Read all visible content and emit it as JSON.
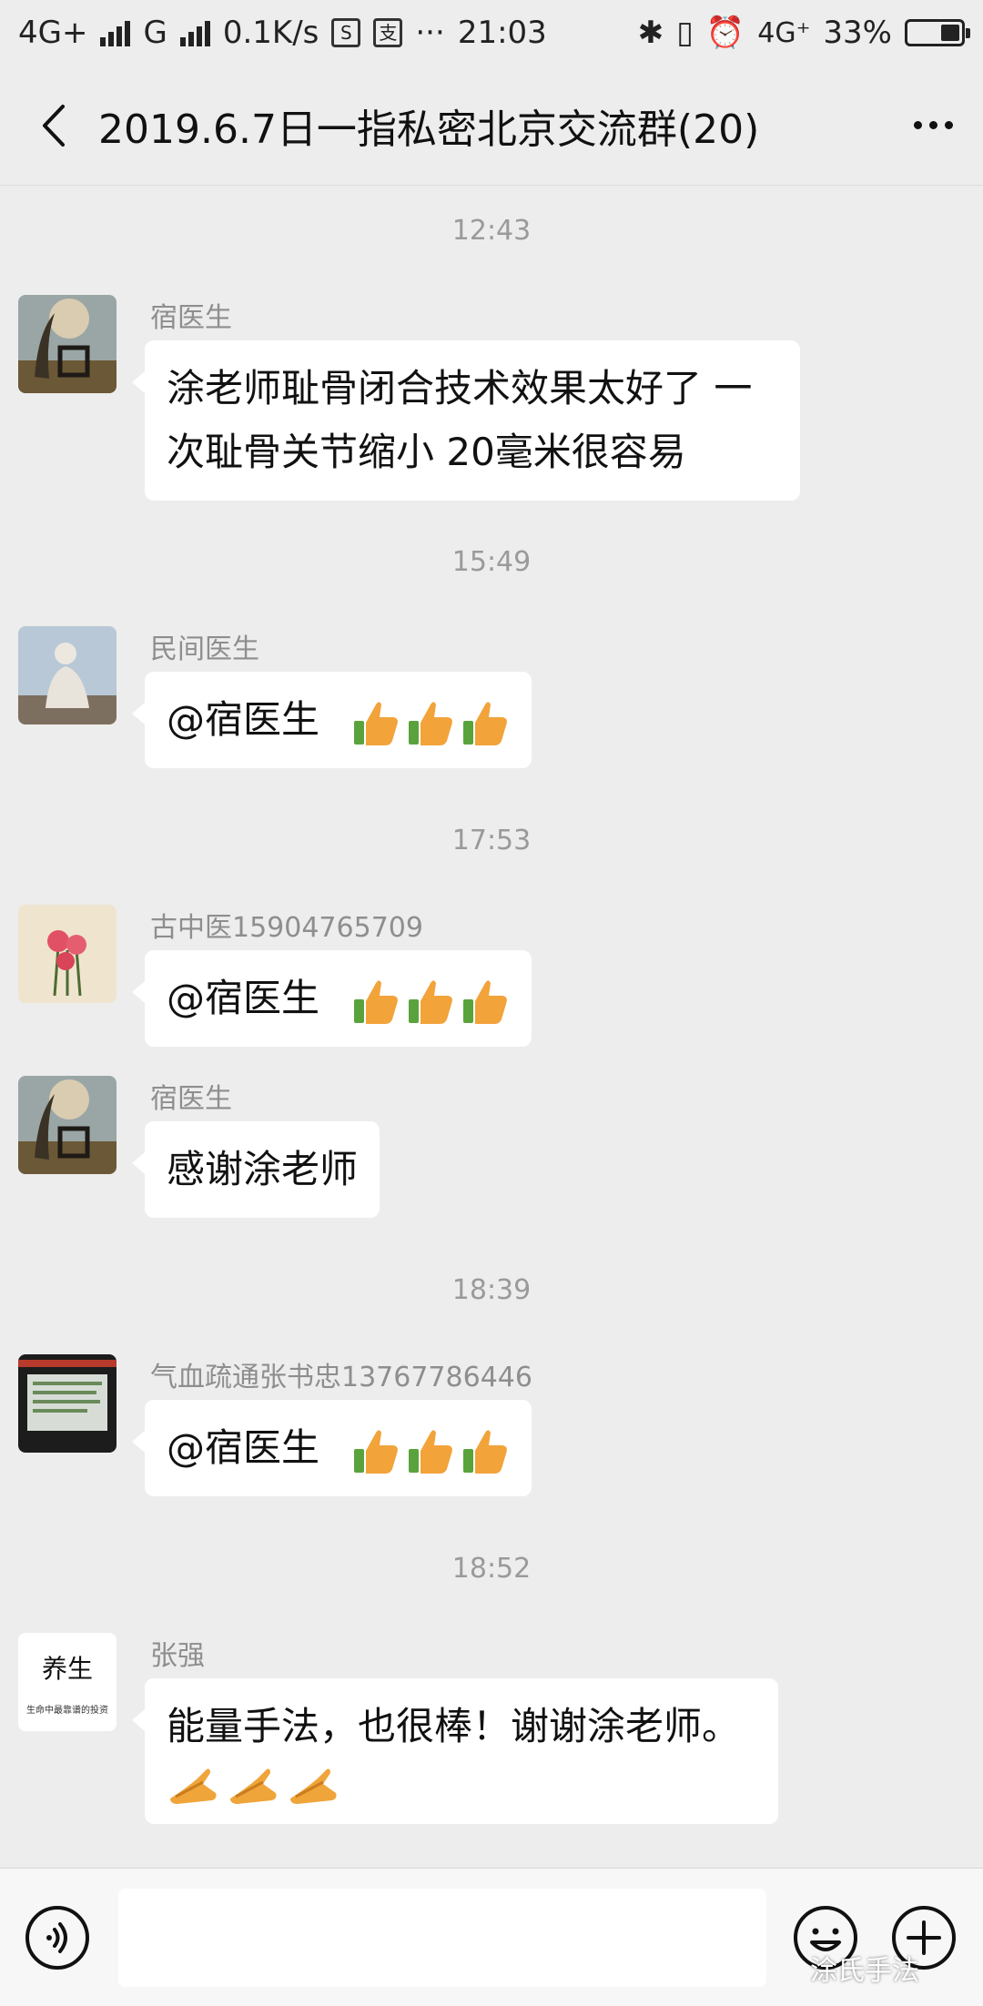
{
  "status_bar": {
    "net1": "4G+",
    "net2": "G",
    "speed": "0.1K/s",
    "icon_s": "S",
    "time": "21:03",
    "net3": "4G⁺",
    "battery": "33%"
  },
  "header": {
    "back_icon": "chevron-left-icon",
    "title": "2019.6.7日一指私密北京交流群(20)",
    "more_icon": "more-horizontal-icon"
  },
  "messages": [
    {
      "type": "time",
      "text": "12:43"
    },
    {
      "type": "msg",
      "sender": "宿医生",
      "text": "涂老师耻骨闭合技术效果太好了 一次耻骨关节缩小 20毫米很容易",
      "avatar": "tree-landscape"
    },
    {
      "type": "time",
      "text": "15:49"
    },
    {
      "type": "msg",
      "sender": "民间医生",
      "text": "@宿医生",
      "emoji": [
        "thumbs-up",
        "thumbs-up",
        "thumbs-up"
      ],
      "avatar": "statue"
    },
    {
      "type": "time",
      "text": "17:53"
    },
    {
      "type": "msg",
      "sender": "古中医15904765709",
      "text": "@宿医生",
      "emoji": [
        "thumbs-up",
        "thumbs-up",
        "thumbs-up"
      ],
      "avatar": "carnations"
    },
    {
      "type": "msg",
      "sender": "宿医生",
      "text": "感谢涂老师",
      "avatar": "tree-landscape"
    },
    {
      "type": "time",
      "text": "18:39"
    },
    {
      "type": "msg",
      "sender": "气血疏通张书忠13767786446",
      "text": "@宿医生",
      "emoji": [
        "thumbs-up",
        "thumbs-up",
        "thumbs-up"
      ],
      "avatar": "lecture-screen"
    },
    {
      "type": "time",
      "text": "18:52"
    },
    {
      "type": "msg",
      "sender": "张强",
      "text": "能量手法，也很棒！谢谢涂老师。",
      "emoji": [
        "clap",
        "clap",
        "clap"
      ],
      "avatar": "text-yangsheng",
      "avatar_text": "养生",
      "avatar_subtext": "生命中最靠谱的投资"
    }
  ],
  "input_bar": {
    "voice_icon": "voice-icon",
    "text_value": "",
    "emoji_icon": "emoji-icon",
    "plus_icon": "plus-icon"
  },
  "watermark": "涂氏手法",
  "colors": {
    "background": "#ededed",
    "bubble": "#ffffff",
    "timestamp": "#9a9a9a",
    "sender": "#8e8e8e"
  }
}
